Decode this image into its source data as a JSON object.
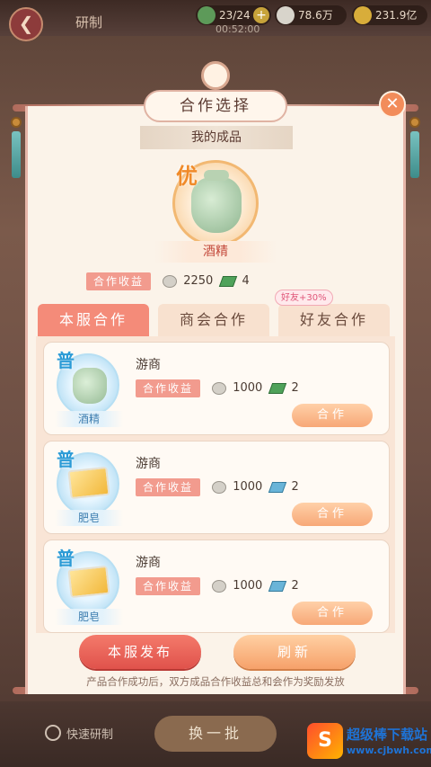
{
  "background": {
    "page_title": "研制",
    "resources": [
      {
        "icon": "energy-icon",
        "value": "23/24"
      },
      {
        "icon": "silver-icon",
        "value": "78.6万"
      },
      {
        "icon": "gold-icon",
        "value": "231.9亿"
      }
    ],
    "timer": "00:52:00",
    "quick_craft_label": "快速研制",
    "swap_batch_label": "换一批"
  },
  "dialog": {
    "title": "合作选择",
    "my_product_label": "我的成品",
    "product": {
      "grade": "优",
      "name": "酒精",
      "income_label": "合作收益",
      "silver": "2250",
      "gems": "4"
    },
    "tabs": [
      {
        "label": "本服合作",
        "active": true
      },
      {
        "label": "商会合作",
        "active": false
      },
      {
        "label": "好友合作",
        "active": false
      }
    ],
    "friend_bonus": "好友+30%",
    "offers": [
      {
        "grade": "普",
        "item": "酒精",
        "partner": "游商",
        "income_label": "合作收益",
        "silver": "1000",
        "gems": "2",
        "gem_color": "#4fa25a",
        "button": "合作"
      },
      {
        "grade": "普",
        "item": "肥皂",
        "partner": "游商",
        "income_label": "合作收益",
        "silver": "1000",
        "gems": "2",
        "gem_color": "#69b4d8",
        "button": "合作"
      },
      {
        "grade": "普",
        "item": "肥皂",
        "partner": "游商",
        "income_label": "合作收益",
        "silver": "1000",
        "gems": "2",
        "gem_color": "#69b4d8",
        "button": "合作"
      }
    ],
    "publish_button": "本服发布",
    "refresh_button": "刷新",
    "footer_note": "产品合作成功后，双方成品合作收益总和会作为奖励发放"
  },
  "watermark": {
    "title": "超级棒下载站",
    "url": "www.cjbwh.com"
  }
}
